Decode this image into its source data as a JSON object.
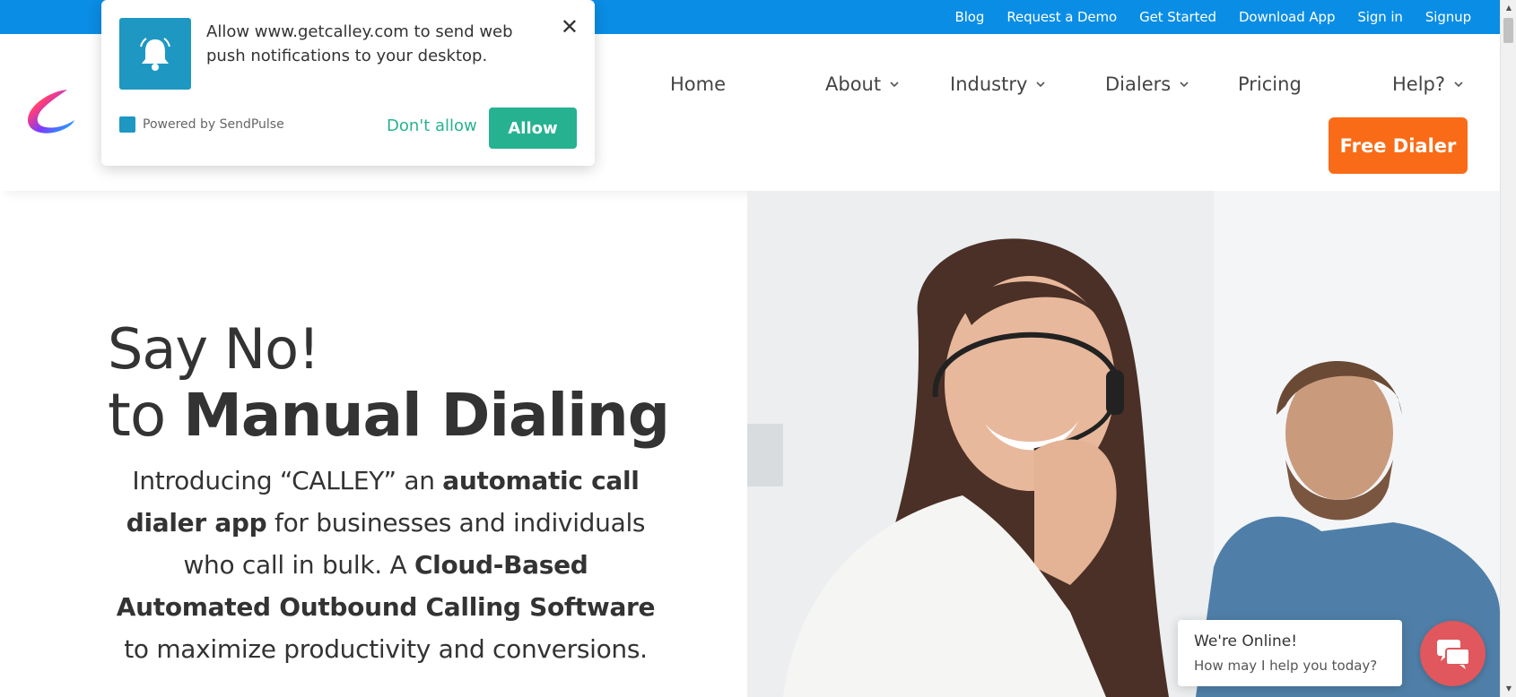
{
  "topbar": {
    "links": [
      "Blog",
      "Request a Demo",
      "Get Started",
      "Download App",
      "Sign in",
      "Signup"
    ]
  },
  "nav": {
    "home": "Home",
    "about": "About",
    "industry": "Industry",
    "dialers": "Dialers",
    "pricing": "Pricing",
    "help": "Help?",
    "cta": "Free Dialer"
  },
  "hero": {
    "line1": "Say No!",
    "line2_prefix": "to ",
    "line2_bold": "Manual Dialing",
    "intro": {
      "p1": "Introducing “CALLEY” an ",
      "b1": "automatic call dialer app",
      "p2": " for businesses and individuals who call in bulk. A ",
      "b2": "Cloud-Based Automated Outbound Calling Software",
      "p3": " to maximize productivity and conversions."
    }
  },
  "notification": {
    "message": "Allow www.getcalley.com to send web push notifications to your desktop.",
    "powered_by": "Powered by SendPulse",
    "dont_allow": "Don't allow",
    "allow": "Allow",
    "close": "✕"
  },
  "chat": {
    "title": "We're Online!",
    "subtitle": "How may I help you today?"
  },
  "colors": {
    "topbar": "#0a8de4",
    "cta": "#f96b16",
    "allow": "#26b291",
    "chat": "#e0575d"
  }
}
